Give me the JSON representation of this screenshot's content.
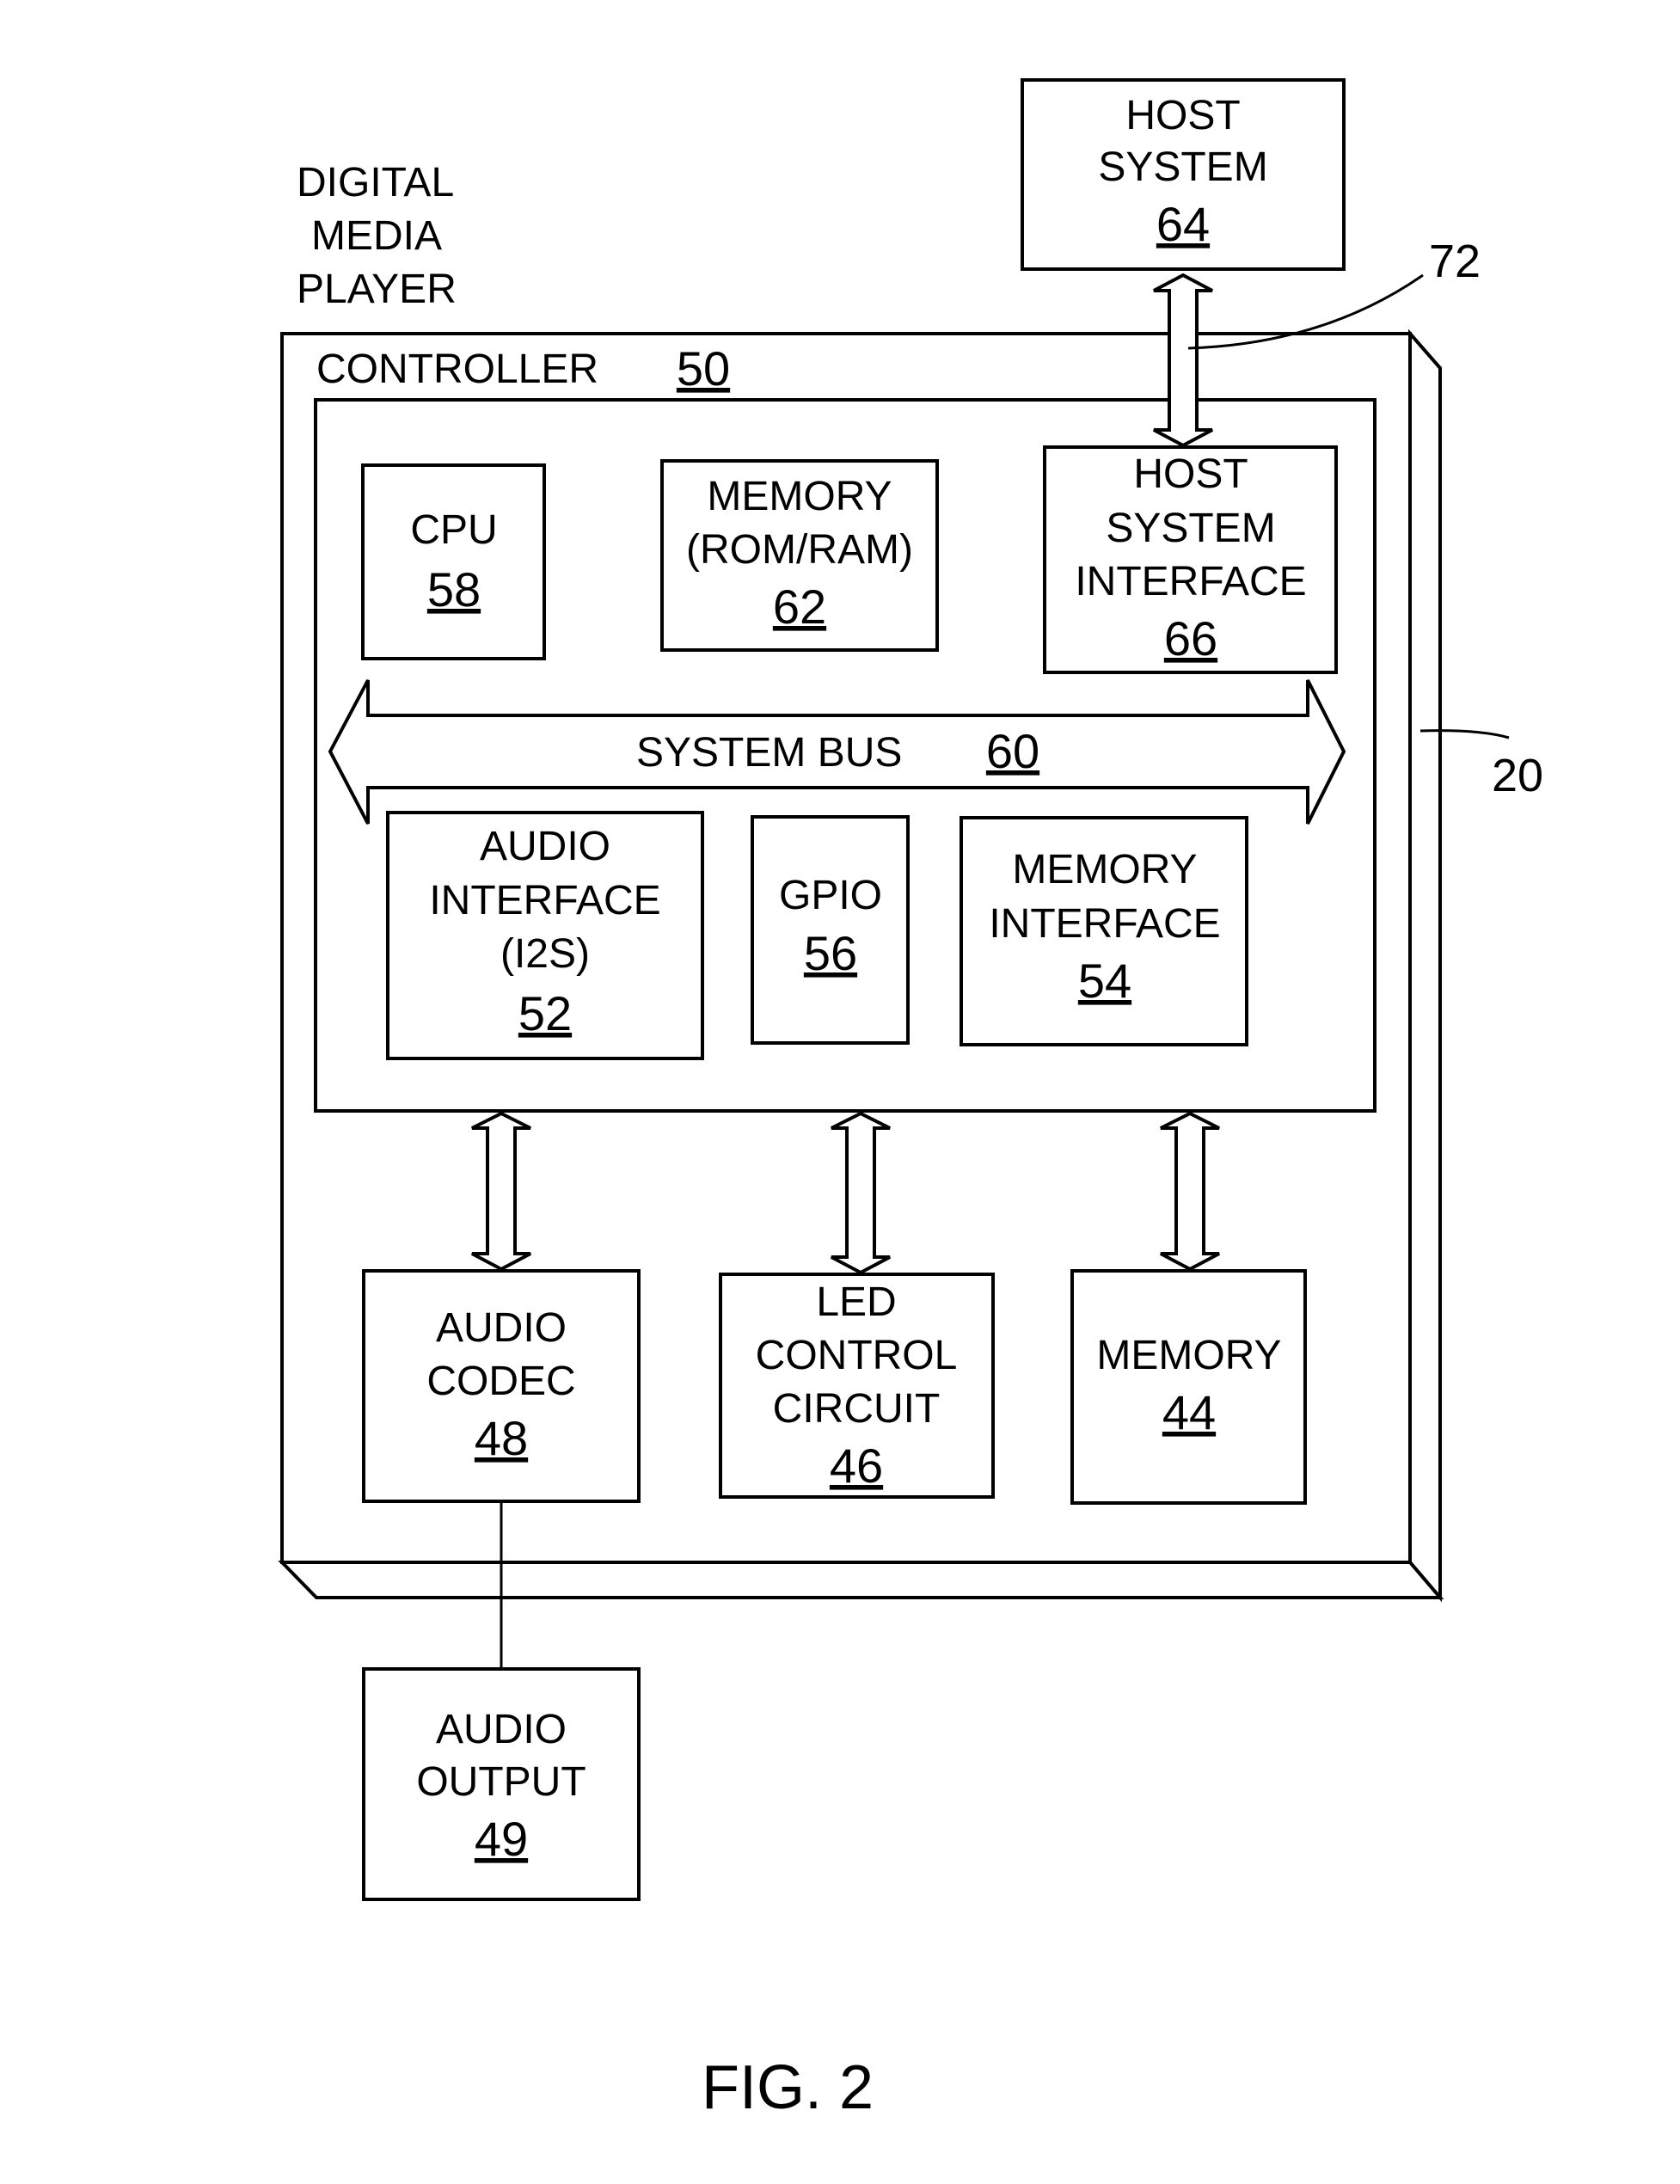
{
  "figure_label": "FIG. 2",
  "device": {
    "lines": [
      "DIGITAL",
      "MEDIA",
      "PLAYER"
    ],
    "ref": "20"
  },
  "controller": {
    "label": "CONTROLLER",
    "ref": "50"
  },
  "host_system": {
    "lines": [
      "HOST",
      "SYSTEM"
    ],
    "ref": "64"
  },
  "host_link_ref": "72",
  "blocks": {
    "cpu": {
      "lines": [
        "CPU"
      ],
      "ref": "58"
    },
    "memory_rom_ram": {
      "lines": [
        "MEMORY",
        "(ROM/RAM)"
      ],
      "ref": "62"
    },
    "host_system_interface": {
      "lines": [
        "HOST",
        "SYSTEM",
        "INTERFACE"
      ],
      "ref": "66"
    },
    "system_bus": {
      "label": "SYSTEM BUS",
      "ref": "60"
    },
    "audio_interface": {
      "lines": [
        "AUDIO",
        "INTERFACE",
        "(I2S)"
      ],
      "ref": "52"
    },
    "gpio": {
      "lines": [
        "GPIO"
      ],
      "ref": "56"
    },
    "memory_interface": {
      "lines": [
        "MEMORY",
        "INTERFACE"
      ],
      "ref": "54"
    },
    "audio_codec": {
      "lines": [
        "AUDIO",
        "CODEC"
      ],
      "ref": "48"
    },
    "led_control": {
      "lines": [
        "LED",
        "CONTROL",
        "CIRCUIT"
      ],
      "ref": "46"
    },
    "memory": {
      "lines": [
        "MEMORY"
      ],
      "ref": "44"
    },
    "audio_output": {
      "lines": [
        "AUDIO",
        "OUTPUT"
      ],
      "ref": "49"
    }
  }
}
